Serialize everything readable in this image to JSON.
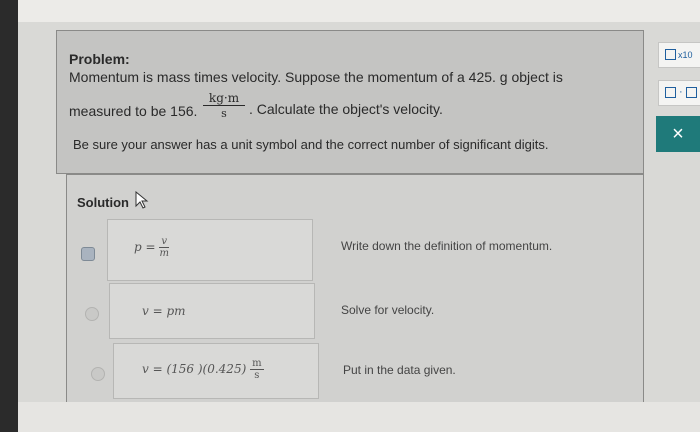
{
  "problem": {
    "heading": "Problem:",
    "line1": "Momentum is mass times velocity. Suppose the momentum of a 425. g object is",
    "line2_start": "measured to be 156.",
    "fraction": {
      "numerator": "kg·m",
      "denominator": "s"
    },
    "line2_end": ". Calculate the object's velocity.",
    "note": "Be sure your answer has a unit symbol and the correct number of significant digits."
  },
  "solution": {
    "heading": "Solution",
    "steps": [
      {
        "eq_lhs": "p =",
        "eq_num": "v",
        "eq_den": "m",
        "text": "Write down the definition of momentum."
      },
      {
        "eq": "v = pm",
        "text": "Solve for velocity."
      },
      {
        "eq": "v = (156 )(0.425)",
        "eq_num": "m",
        "eq_den": "s",
        "text": "Put in the data given."
      }
    ]
  },
  "toolbar": {
    "sci_notation_label": "x10",
    "decimal_label": "·",
    "close_label": "×"
  }
}
